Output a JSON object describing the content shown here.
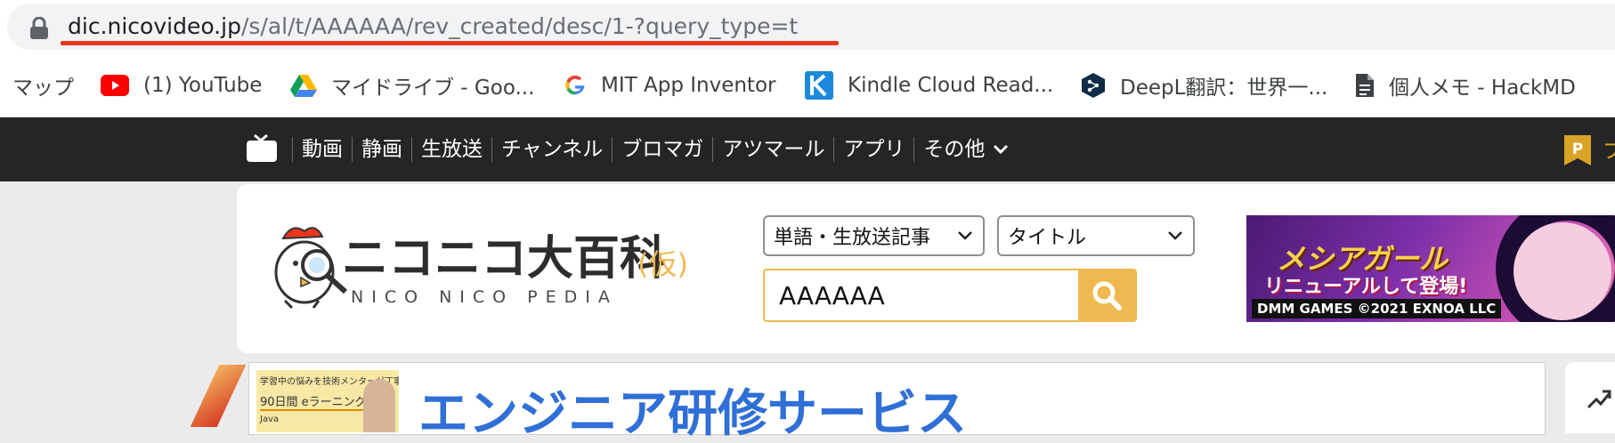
{
  "browser": {
    "url_host": "dic.nicovideo.jp",
    "url_path": "/s/al/t/AAAAAA/rev_created/desc/1-?query_type=t"
  },
  "bookmarks": [
    {
      "label": "マップ",
      "icon": "none"
    },
    {
      "label": "(1) YouTube",
      "icon": "youtube-icon"
    },
    {
      "label": "マイドライブ - Goo...",
      "icon": "google-drive-icon"
    },
    {
      "label": "MIT App Inventor",
      "icon": "google-icon"
    },
    {
      "label": "Kindle Cloud Read...",
      "icon": "kindle-icon"
    },
    {
      "label": "DeepL翻訳：世界一...",
      "icon": "deepl-icon"
    },
    {
      "label": "個人メモ - HackMD",
      "icon": "document-icon"
    }
  ],
  "nico_nav": {
    "items": [
      "動画",
      "静画",
      "生放送",
      "チャンネル",
      "ブロマガ",
      "アツマール",
      "アプリ",
      "その他"
    ],
    "premium_text": "プ"
  },
  "search": {
    "category_select": "単語・生放送記事",
    "field_select": "タイトル",
    "query": "AAAAAA"
  },
  "logo": {
    "main": "ニコニコ大百科",
    "tag": "(仮)",
    "sub": "NICO NICO PEDIA"
  },
  "banner": {
    "title": "メシアガール",
    "subtitle": "リニューアルして登場!",
    "brand": "DMM GAMES ©2021 EXNOA LLC"
  },
  "ad": {
    "thumb_line1": "学習中の悩みを技術メンターが丁寧に対応!",
    "thumb_line2": "90日間 eラーニング",
    "thumb_line3": "Java",
    "title": "エンジニア研修サービス"
  },
  "colors": {
    "url_highlight": "#e8371d",
    "nico_header": "#252525",
    "search_accent": "#f0b850",
    "ad_title": "#2f6fd6"
  }
}
